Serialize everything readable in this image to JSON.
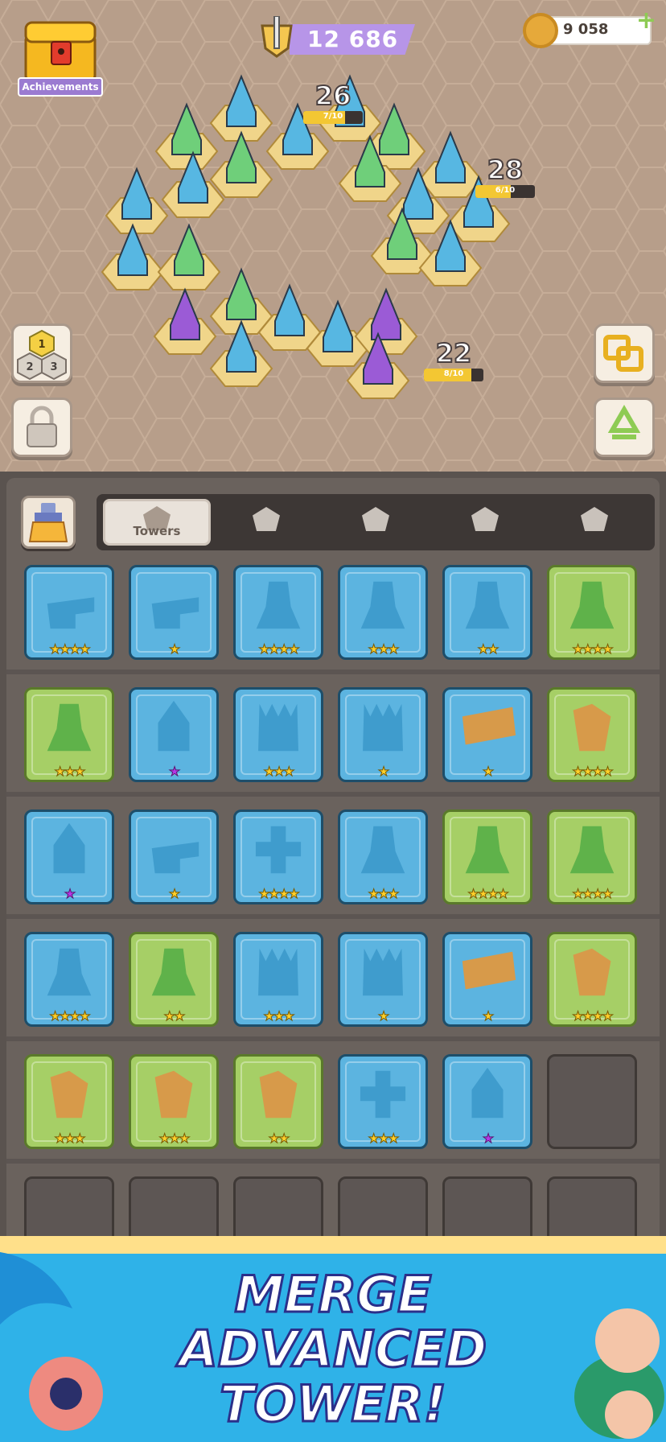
{
  "hud": {
    "achievements_label": "Achievements",
    "trophies": "12 686",
    "coins": "9 058",
    "add_icon": "plus-icon"
  },
  "board_levels": [
    {
      "level": "26",
      "progress": "7/10",
      "fraction": 0.7
    },
    {
      "level": "28",
      "progress": "6/10",
      "fraction": 0.6
    },
    {
      "level": "22",
      "progress": "8/10",
      "fraction": 0.8
    }
  ],
  "side_buttons": {
    "numbers": [
      "1",
      "2",
      "3"
    ],
    "lock_icon": "lock-icon",
    "merge_icon": "merge-squares-icon",
    "recycle_icon": "recycle-icon"
  },
  "tabs": [
    {
      "label": "Towers",
      "icon": "castle-icon",
      "active": true
    },
    {
      "label": "",
      "icon": "claw-icon",
      "active": false
    },
    {
      "label": "",
      "icon": "helmet-icon",
      "active": false
    },
    {
      "label": "",
      "icon": "demon-icon",
      "active": false
    },
    {
      "label": "",
      "icon": "gem-icon",
      "active": false
    }
  ],
  "inventory": [
    [
      {
        "t": "cannon",
        "c": "blue",
        "s": "★★★★",
        "p": false
      },
      {
        "t": "cannon",
        "c": "blue",
        "s": "★",
        "p": false
      },
      {
        "t": "axe",
        "c": "blue",
        "s": "★★★★",
        "p": false
      },
      {
        "t": "axe",
        "c": "blue",
        "s": "★★★",
        "p": false
      },
      {
        "t": "axe",
        "c": "blue",
        "s": "★★",
        "p": false
      },
      {
        "t": "archer",
        "c": "green",
        "s": "★★★★",
        "p": false
      }
    ],
    [
      {
        "t": "archer",
        "c": "green",
        "s": "★★★",
        "p": false
      },
      {
        "t": "spire",
        "c": "blue",
        "s": "★",
        "p": true
      },
      {
        "t": "spikes",
        "c": "blue",
        "s": "★★★",
        "p": false
      },
      {
        "t": "spikes",
        "c": "blue",
        "s": "★",
        "p": false
      },
      {
        "t": "log",
        "c": "blue",
        "s": "★",
        "p": false
      },
      {
        "t": "catapult",
        "c": "green",
        "s": "★★★★",
        "p": false
      }
    ],
    [
      {
        "t": "spire",
        "c": "blue",
        "s": "★",
        "p": true
      },
      {
        "t": "cannon",
        "c": "blue",
        "s": "★",
        "p": false
      },
      {
        "t": "cross",
        "c": "blue",
        "s": "★★★★",
        "p": false
      },
      {
        "t": "axe",
        "c": "blue",
        "s": "★★★",
        "p": false
      },
      {
        "t": "archer",
        "c": "green",
        "s": "★★★★",
        "p": false
      },
      {
        "t": "archer",
        "c": "green",
        "s": "★★★★",
        "p": false
      }
    ],
    [
      {
        "t": "axe",
        "c": "blue",
        "s": "★★★★",
        "p": false
      },
      {
        "t": "archer",
        "c": "green",
        "s": "★★",
        "p": false
      },
      {
        "t": "spikes",
        "c": "blue",
        "s": "★★★",
        "p": false
      },
      {
        "t": "spikes",
        "c": "blue",
        "s": "★",
        "p": false
      },
      {
        "t": "log",
        "c": "blue",
        "s": "★",
        "p": false
      },
      {
        "t": "catapult",
        "c": "green",
        "s": "★★★★",
        "p": false
      }
    ],
    [
      {
        "t": "catapult",
        "c": "green",
        "s": "★★★",
        "p": false
      },
      {
        "t": "catapult",
        "c": "green",
        "s": "★★★",
        "p": false
      },
      {
        "t": "catapult",
        "c": "green",
        "s": "★★",
        "p": false
      },
      {
        "t": "cross",
        "c": "blue",
        "s": "★★★",
        "p": false
      },
      {
        "t": "spire",
        "c": "blue",
        "s": "★",
        "p": true
      },
      {
        "t": "empty",
        "c": "empty",
        "s": "",
        "p": false
      }
    ]
  ],
  "banner": {
    "line1": "MERGE",
    "line2": "ADVANCED",
    "line3": "TOWER!"
  },
  "colors": {
    "blue_cell": "#5cb4e0",
    "green_cell": "#a6cf66",
    "star_gold": "#ffd02a",
    "star_purple": "#b636e8",
    "trophy_pill": "#b795e8"
  }
}
